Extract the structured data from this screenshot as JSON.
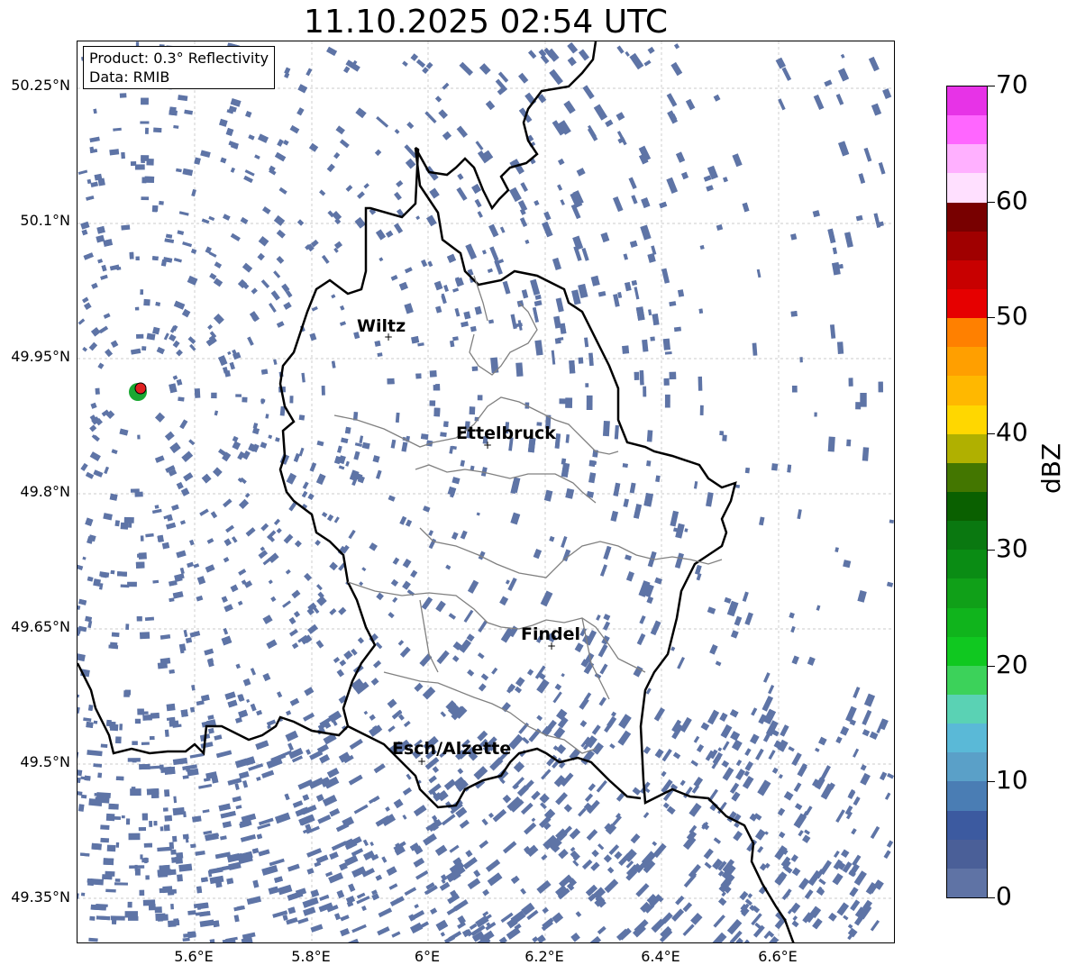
{
  "title": "11.10.2025 02:54 UTC",
  "info": {
    "product": "Product: 0.3° Reflectivity",
    "data": "Data: RMIB"
  },
  "lat_ticks": [
    "50.25°N",
    "50.1°N",
    "49.95°N",
    "49.8°N",
    "49.65°N",
    "49.5°N",
    "49.35°N"
  ],
  "lon_ticks": [
    "5.6°E",
    "5.8°E",
    "6°E",
    "6.2°E",
    "6.4°E",
    "6.6°E"
  ],
  "cities": [
    "Wiltz",
    "Ettelbruck",
    "Findel",
    "Esch/Alzette"
  ],
  "colorbar": {
    "label": "dBZ",
    "ticks": [
      "70",
      "60",
      "50",
      "40",
      "30",
      "20",
      "10",
      "0"
    ],
    "colors": [
      "#e733e7",
      "#ff66ff",
      "#ffb0ff",
      "#ffe0ff",
      "#780000",
      "#a00000",
      "#c80000",
      "#e60000",
      "#ff8000",
      "#ff9f00",
      "#ffb800",
      "#ffd700",
      "#b0b000",
      "#437600",
      "#0a6000",
      "#0a7810",
      "#0a8c14",
      "#10a018",
      "#10b41c",
      "#10c820",
      "#3cd25a",
      "#5ad2b4",
      "#5ab9d7",
      "#5aa0c8",
      "#4a7db4",
      "#3c5aa0",
      "#4a5f98",
      "#5f73a5"
    ]
  },
  "radar_color": "#5e74a6",
  "border_color": "#000000",
  "canton_color": "#808080"
}
